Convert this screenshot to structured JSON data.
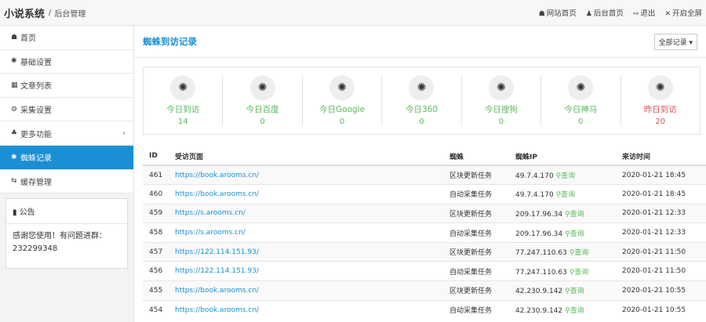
{
  "header": {
    "brand": "小说系统",
    "separator": "/",
    "subtitle": "后台管理",
    "nav": [
      {
        "icon": "home-icon",
        "glyph": "☗",
        "label": "网站首页"
      },
      {
        "icon": "user-icon",
        "glyph": "♟",
        "label": "后台首页"
      },
      {
        "icon": "logout-icon",
        "glyph": "⇨",
        "label": "退出"
      },
      {
        "icon": "fullscreen-icon",
        "glyph": "✕",
        "label": "开启全屏"
      }
    ]
  },
  "sidebar": {
    "items": [
      {
        "icon": "home-icon",
        "glyph": "☗",
        "label": "首页"
      },
      {
        "icon": "gear-icon",
        "glyph": "✱",
        "label": "基础设置"
      },
      {
        "icon": "table-icon",
        "glyph": "▦",
        "label": "文章列表"
      },
      {
        "icon": "gears-icon",
        "glyph": "⚙",
        "label": "采集设置"
      },
      {
        "icon": "sitemap-icon",
        "glyph": "♣",
        "label": "更多功能",
        "chevron": "›"
      },
      {
        "icon": "bug-icon",
        "glyph": "✺",
        "label": "蜘蛛记录"
      },
      {
        "icon": "refresh-icon",
        "glyph": "⇆",
        "label": "缓存管理"
      }
    ],
    "notice": {
      "title": "公告",
      "body": "感谢您使用！有问题进群：232299348"
    }
  },
  "main": {
    "title": "蜘蛛到访记录",
    "filter": "全部记录",
    "stats": [
      {
        "label": "今日到访",
        "value": "14"
      },
      {
        "label": "今日百度",
        "value": "0"
      },
      {
        "label": "今日Google",
        "value": "0"
      },
      {
        "label": "今日360",
        "value": "0"
      },
      {
        "label": "今日搜狗",
        "value": "0"
      },
      {
        "label": "今日神马",
        "value": "0"
      },
      {
        "label": "昨日到访",
        "value": "20"
      }
    ],
    "columns": [
      "ID",
      "受访页面",
      "蜘蛛",
      "蜘蛛IP",
      "来访时间"
    ],
    "query_label": "查询",
    "rows": [
      [
        "461",
        "https://book.arooms.cn/",
        "区块更新任务",
        "49.7.4.170",
        "2020-01-21 18:45"
      ],
      [
        "460",
        "https://book.arooms.cn/",
        "自动采集任务",
        "49.7.4.170",
        "2020-01-21 18:45"
      ],
      [
        "459",
        "https://s.arooms.cn/",
        "区块更新任务",
        "209.17.96.34",
        "2020-01-21 12:33"
      ],
      [
        "458",
        "https://s.arooms.cn/",
        "自动采集任务",
        "209.17.96.34",
        "2020-01-21 12:33"
      ],
      [
        "457",
        "https://122.114.151.93/",
        "区块更新任务",
        "77.247.110.63",
        "2020-01-21 11:50"
      ],
      [
        "456",
        "https://122.114.151.93/",
        "自动采集任务",
        "77.247.110.63",
        "2020-01-21 11:50"
      ],
      [
        "455",
        "https://book.arooms.cn/",
        "区块更新任务",
        "42.230.9.142",
        "2020-01-21 10:55"
      ],
      [
        "454",
        "https://book.arooms.cn/",
        "自动采集任务",
        "42.230.9.142",
        "2020-01-21 10:55"
      ]
    ]
  }
}
